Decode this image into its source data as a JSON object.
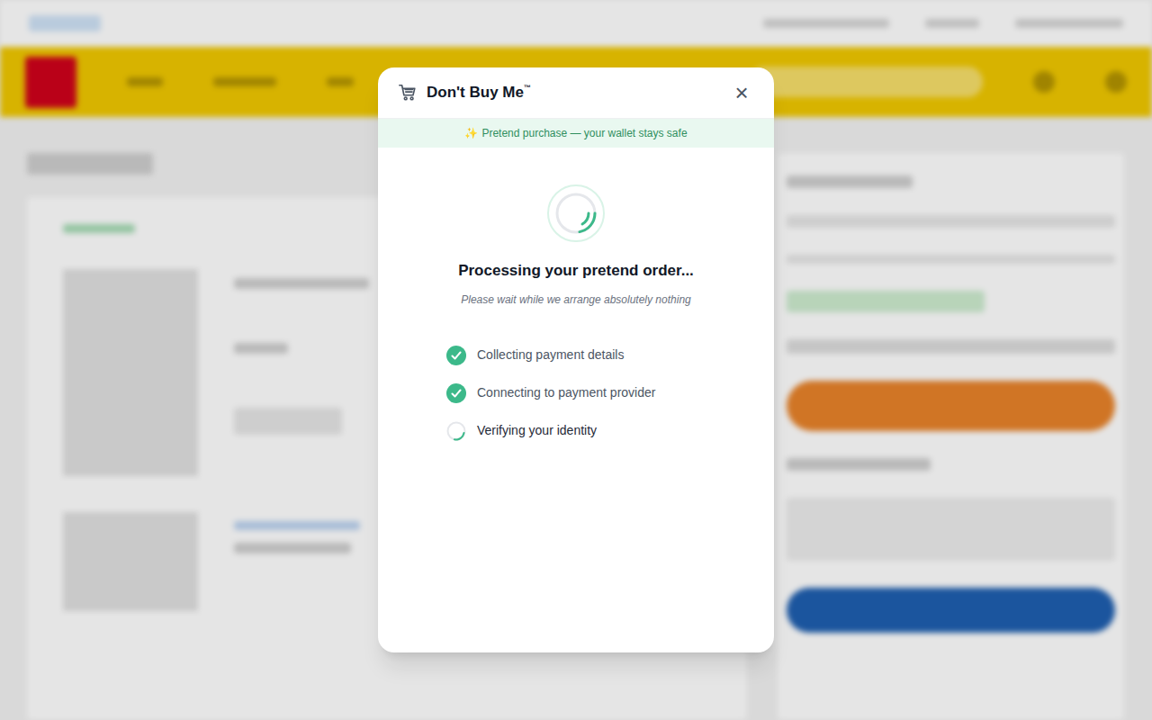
{
  "modal": {
    "title": "Don't Buy Me",
    "trademark": "™",
    "close": "×",
    "banner": {
      "icon": "✨",
      "text": "Pretend purchase — your wallet stays safe"
    },
    "heading": "Processing your pretend order...",
    "subheading": "Please wait while we arrange absolutely nothing",
    "steps": [
      {
        "label": "Collecting payment details",
        "done": true
      },
      {
        "label": "Connecting to payment provider",
        "done": true
      },
      {
        "label": "Verifying your identity",
        "done": false
      }
    ]
  }
}
